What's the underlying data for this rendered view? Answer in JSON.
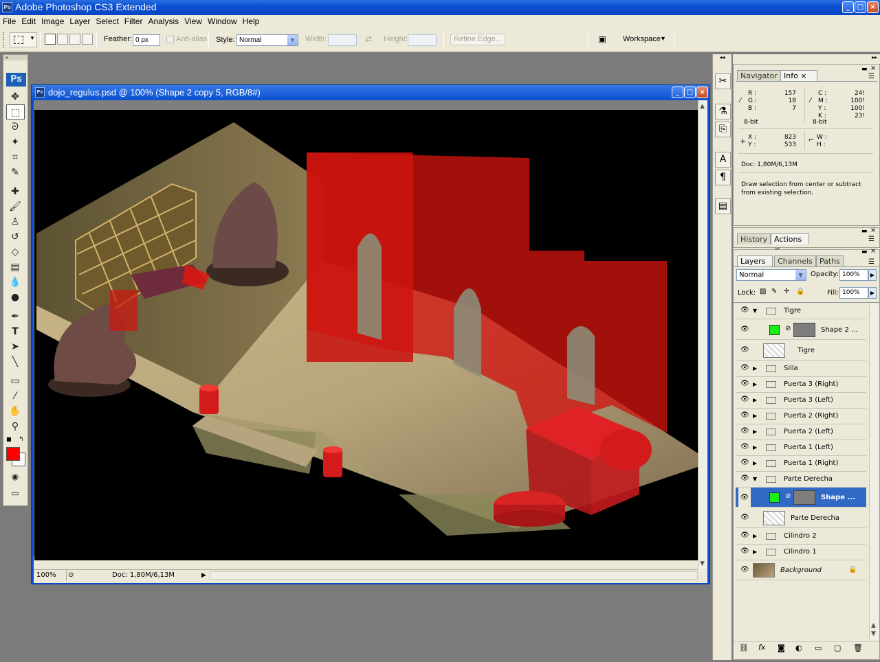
{
  "app": {
    "title": "Adobe Photoshop CS3 Extended",
    "ps_badge": "Ps"
  },
  "menu": [
    "File",
    "Edit",
    "Image",
    "Layer",
    "Select",
    "Filter",
    "Analysis",
    "View",
    "Window",
    "Help"
  ],
  "options": {
    "feather_label": "Feather:",
    "feather_value": "0 px",
    "antialias_label": "Anti-alias",
    "style_label": "Style:",
    "style_value": "Normal",
    "width_label": "Width:",
    "height_label": "Height:",
    "refine_edge": "Refine Edge...",
    "workspace": "Workspace"
  },
  "document": {
    "title": "dojo_regulus.psd @ 100% (Shape 2 copy 5, RGB/8#)",
    "zoom": "100%",
    "doc_size": "Doc: 1,80M/6,13M"
  },
  "info": {
    "tabs": [
      "Navigator",
      "Info"
    ],
    "R": "157",
    "G": "18",
    "B": "7",
    "C": "24!",
    "M": "100!",
    "Y": "100!",
    "K": "23!",
    "bit_left": "8-bit",
    "bit_right": "8-bit",
    "X": "823",
    "Y_coord": "533",
    "labels": {
      "R": "R :",
      "G": "G :",
      "B": "B :",
      "C": "C :",
      "M": "M :",
      "Y": "Y :",
      "K": "K :",
      "X": "X :",
      "Yc": "Y :",
      "W": "W :",
      "H": "H :"
    },
    "doc": "Doc: 1,80M/6,13M",
    "hint": "Draw selection from center or subtract from existing selection."
  },
  "history": {
    "tabs": [
      "History",
      "Actions"
    ]
  },
  "layers_panel": {
    "tabs": [
      "Layers",
      "Channels",
      "Paths"
    ],
    "blend_mode": "Normal",
    "opacity_label": "Opacity:",
    "opacity": "100%",
    "lock_label": "Lock:",
    "fill_label": "Fill:",
    "fill": "100%",
    "layers": [
      {
        "name": "Tigre",
        "type": "group",
        "expanded": true
      },
      {
        "name": "Shape 2 ...",
        "type": "shape",
        "indent": true
      },
      {
        "name": "Tigre",
        "type": "pixel",
        "indent": true
      },
      {
        "name": "Silla",
        "type": "group"
      },
      {
        "name": "Puerta 3 (Right)",
        "type": "group"
      },
      {
        "name": "Puerta 3 (Left)",
        "type": "group"
      },
      {
        "name": "Puerta 2 (Right)",
        "type": "group"
      },
      {
        "name": "Puerta 2 (Left)",
        "type": "group"
      },
      {
        "name": "Puerta 1 (Left)",
        "type": "group"
      },
      {
        "name": "Puerta 1 (Right)",
        "type": "group"
      },
      {
        "name": "Parte Derecha",
        "type": "group",
        "expanded": true
      },
      {
        "name": "Shape ...",
        "type": "shape",
        "indent": true,
        "selected": true
      },
      {
        "name": "Parte Derecha",
        "type": "pixel",
        "indent": true
      },
      {
        "name": "Cilindro 2",
        "type": "group"
      },
      {
        "name": "Cilindro 1",
        "type": "group"
      },
      {
        "name": "Background",
        "type": "background"
      }
    ]
  },
  "colors": {
    "foreground": "#ff0000",
    "background": "#ffffff",
    "accent": "#316ac5"
  }
}
